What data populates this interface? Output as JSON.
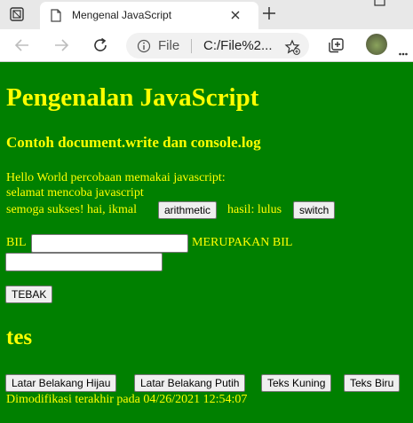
{
  "browser": {
    "tab_title": "Mengenal JavaScript",
    "address_label": "File",
    "address_url": "C:/File%2..."
  },
  "page": {
    "heading": "Pengenalan JavaScript",
    "subheading": "Contoh document.write dan console.log",
    "line1": "Hello World percobaan memakai javascript:",
    "line2": "selamat mencoba javascript",
    "line3_prefix": "semoga sukses! hai, ikmal",
    "btn_arithmetic": "arithmetic",
    "line3_middle": "hasil: lulus",
    "btn_switch": "switch",
    "bil_label": "BIL",
    "bil_input_value": "",
    "merupakan_label": "MERUPAKAN BIL",
    "result_input_value": "",
    "btn_tebak": "TEBAK",
    "section_title": "tes",
    "btn_bg_green": "Latar Belakang Hijau",
    "btn_bg_white": "Latar Belakang Putih",
    "btn_text_yellow": "Teks Kuning",
    "btn_text_blue": "Teks Biru",
    "footer": "Dimodifikasi terakhir pada 04/26/2021 12:54:07"
  },
  "colors": {
    "page_background": "#008000",
    "page_text": "#ffff00"
  },
  "icons": {
    "tab_actions": "tab-actions-icon",
    "favicon": "page-favicon-icon",
    "close": "close-icon",
    "new_tab": "plus-icon",
    "back": "arrow-left-icon",
    "forward": "arrow-right-icon",
    "refresh": "refresh-icon",
    "info": "info-icon",
    "add_favorite": "star-plus-icon",
    "collections": "collections-icon",
    "profile": "avatar",
    "more": "more-icon"
  }
}
